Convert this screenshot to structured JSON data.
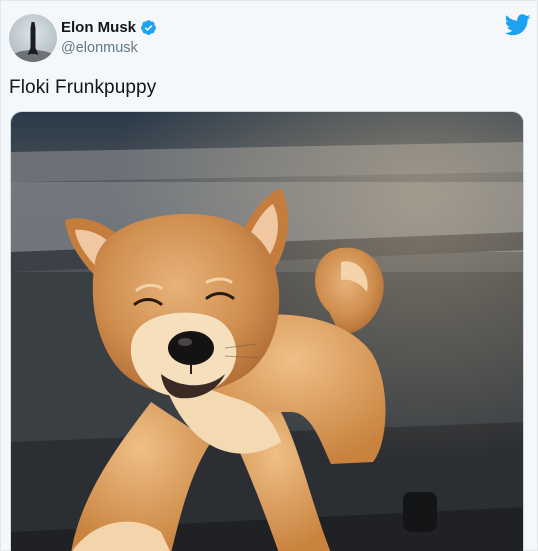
{
  "author": {
    "display_name": "Elon Musk",
    "handle": "@elonmusk",
    "verified": true,
    "avatar_icon": "avatar-rocket-icon"
  },
  "tweet": {
    "text": "Floki Frunkpuppy"
  },
  "brand": {
    "icon": "twitter-bird-icon",
    "color": "#1da1f2"
  },
  "media": {
    "subject": "shiba-inu-puppy-photo"
  },
  "colors": {
    "verified_badge": "#1da1f2",
    "text_primary": "#14171a",
    "text_secondary": "#657786",
    "background": "#f5f8fa"
  }
}
